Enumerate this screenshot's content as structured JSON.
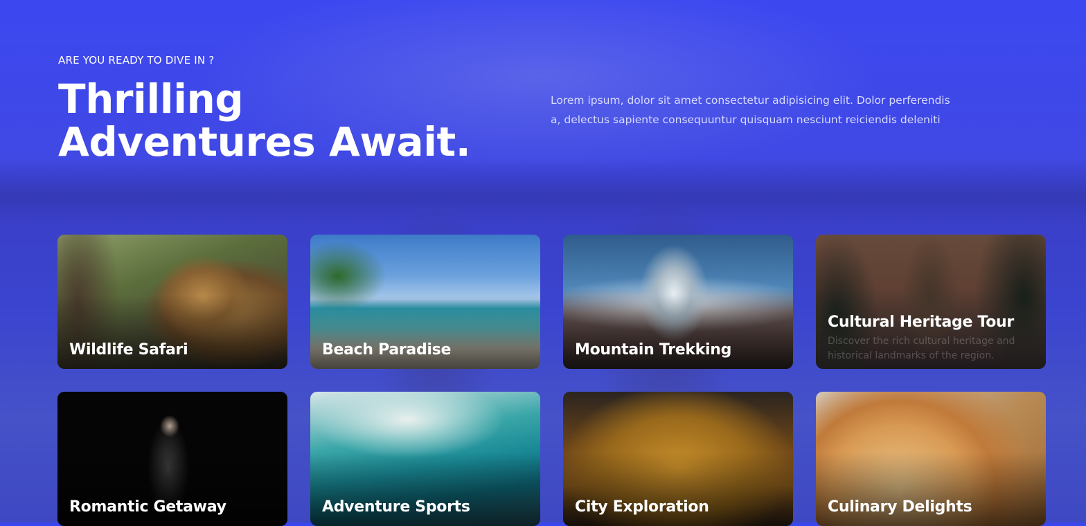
{
  "hero": {
    "eyebrow": "ARE YOU READY TO DIVE IN ?",
    "title": "Thrilling Adventures Await.",
    "description": "Lorem ipsum, dolor sit amet consectetur adipisicing elit. Dolor perferendis a, delectus sapiente consequuntur quisquam nesciunt reiciendis deleniti"
  },
  "cards": [
    {
      "title": "Wildlife Safari",
      "image": "leopard-photo"
    },
    {
      "title": "Beach Paradise",
      "image": "beach-photo"
    },
    {
      "title": "Mountain Trekking",
      "image": "mountain-photo"
    },
    {
      "title": "Cultural Heritage Tour",
      "image": "temple-photo",
      "description": "Discover the rich cultural heritage and historical landmarks of the region."
    },
    {
      "title": "Romantic Getaway",
      "image": "singer-photo"
    },
    {
      "title": "Adventure Sports",
      "image": "surfer-photo"
    },
    {
      "title": "City Exploration",
      "image": "paella-photo"
    },
    {
      "title": "Culinary Delights",
      "image": "pizza-photo"
    }
  ],
  "colors": {
    "background": "#3a47ee",
    "text": "#ffffff",
    "description_text": "#d8dcff"
  }
}
